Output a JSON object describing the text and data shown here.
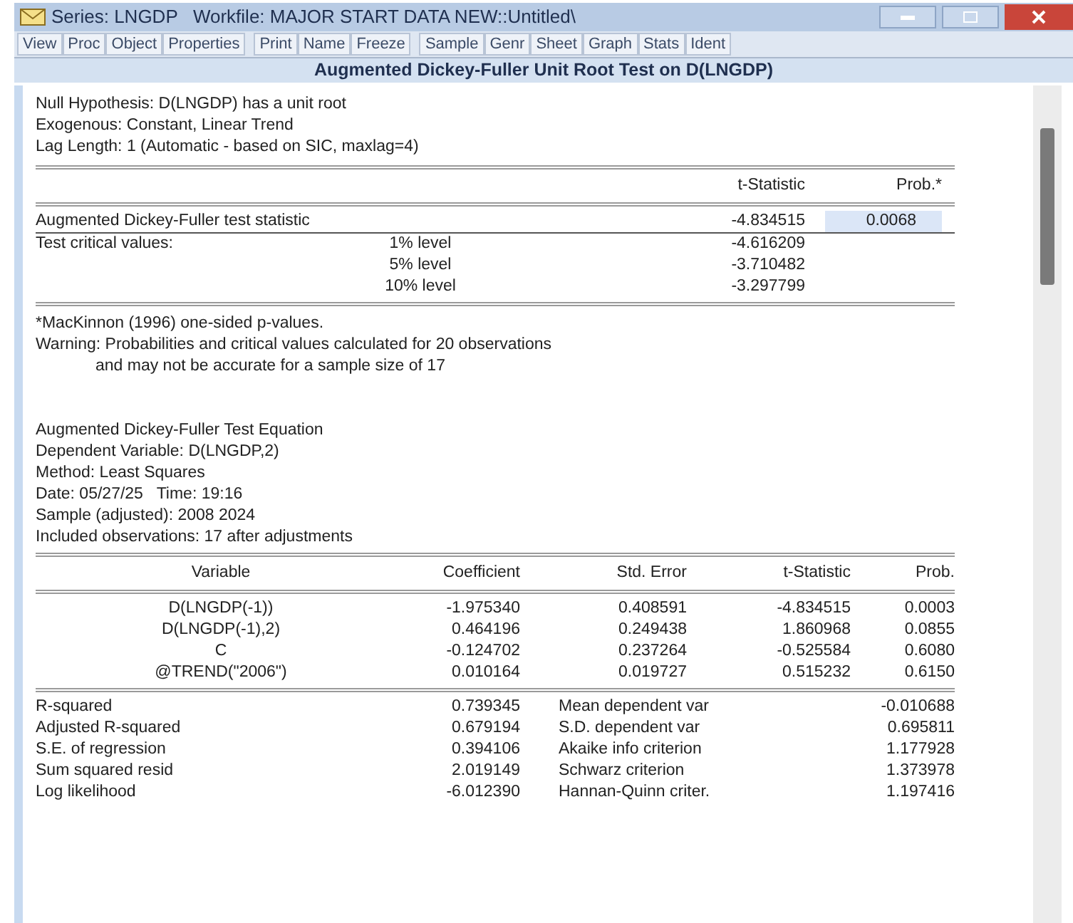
{
  "window": {
    "title": "Series: LNGDP   Workfile: MAJOR START DATA NEW::Untitled\\"
  },
  "toolbar": [
    [
      "View",
      "Proc",
      "Object",
      "Properties"
    ],
    [
      "Print",
      "Name",
      "Freeze"
    ],
    [
      "Sample",
      "Genr",
      "Sheet",
      "Graph",
      "Stats",
      "Ident"
    ]
  ],
  "heading": "Augmented Dickey-Fuller Unit Root Test on D(LNGDP)",
  "header_lines": [
    "Null Hypothesis: D(LNGDP) has a unit root",
    "Exogenous: Constant, Linear Trend",
    "Lag Length: 1 (Automatic - based on SIC, maxlag=4)"
  ],
  "test_table": {
    "columns": [
      "t-Statistic",
      "Prob.*"
    ],
    "statistic": {
      "label": "Augmented Dickey-Fuller test statistic",
      "t_stat": "-4.834515",
      "prob": "0.0068",
      "prob_selected": true
    },
    "critical_label": "Test critical values:",
    "critical": [
      {
        "level": "1% level",
        "value": "-4.616209"
      },
      {
        "level": "5% level",
        "value": "-3.710482"
      },
      {
        "level": "10% level",
        "value": "-3.297799"
      }
    ]
  },
  "notes": [
    "*MacKinnon (1996) one-sided p-values.",
    "Warning: Probabilities and critical values calculated for 20 observations",
    "and may not be accurate for a sample size of 17"
  ],
  "equation_lines": [
    "Augmented Dickey-Fuller Test Equation",
    "Dependent Variable: D(LNGDP,2)",
    "Method: Least Squares",
    "Date: 05/27/25   Time: 19:16",
    "Sample (adjusted): 2008 2024",
    "Included observations: 17 after adjustments"
  ],
  "coef_table": {
    "columns": [
      "Variable",
      "Coefficient",
      "Std. Error",
      "t-Statistic",
      "Prob."
    ],
    "rows": [
      [
        "D(LNGDP(-1))",
        "-1.975340",
        "0.408591",
        "-4.834515",
        "0.0003"
      ],
      [
        "D(LNGDP(-1),2)",
        "0.464196",
        "0.249438",
        "1.860968",
        "0.0855"
      ],
      [
        "C",
        "-0.124702",
        "0.237264",
        "-0.525584",
        "0.6080"
      ],
      [
        "@TREND(\"2006\")",
        "0.010164",
        "0.019727",
        "0.515232",
        "0.6150"
      ]
    ]
  },
  "stats_table": [
    [
      "R-squared",
      "0.739345",
      "Mean dependent var",
      "-0.010688"
    ],
    [
      "Adjusted R-squared",
      "0.679194",
      "S.D. dependent var",
      "0.695811"
    ],
    [
      "S.E. of regression",
      "0.394106",
      "Akaike info criterion",
      "1.177928"
    ],
    [
      "Sum squared resid",
      "2.019149",
      "Schwarz criterion",
      "1.373978"
    ],
    [
      "Log likelihood",
      "-6.012390",
      "Hannan-Quinn criter.",
      "1.197416"
    ]
  ]
}
